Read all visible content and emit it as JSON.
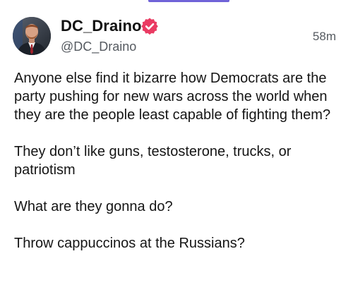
{
  "post": {
    "display_name": "DC_Draino",
    "handle": "@DC_Draino",
    "timestamp": "58m",
    "verified_icon": "verified-badge-icon",
    "paragraphs": [
      "Anyone else find it bizarre how Democrats are the party pushing for new wars across the world when they are the people least capable of fighting them?",
      "They don’t like guns, testosterone, trucks, or patriotism",
      "What are they gonna do?",
      "Throw cappuccinos at the Russians?"
    ]
  },
  "colors": {
    "accent": "#6f63d8",
    "verified_badge": "#ea3b63",
    "text": "#151515",
    "muted": "#555a60"
  }
}
